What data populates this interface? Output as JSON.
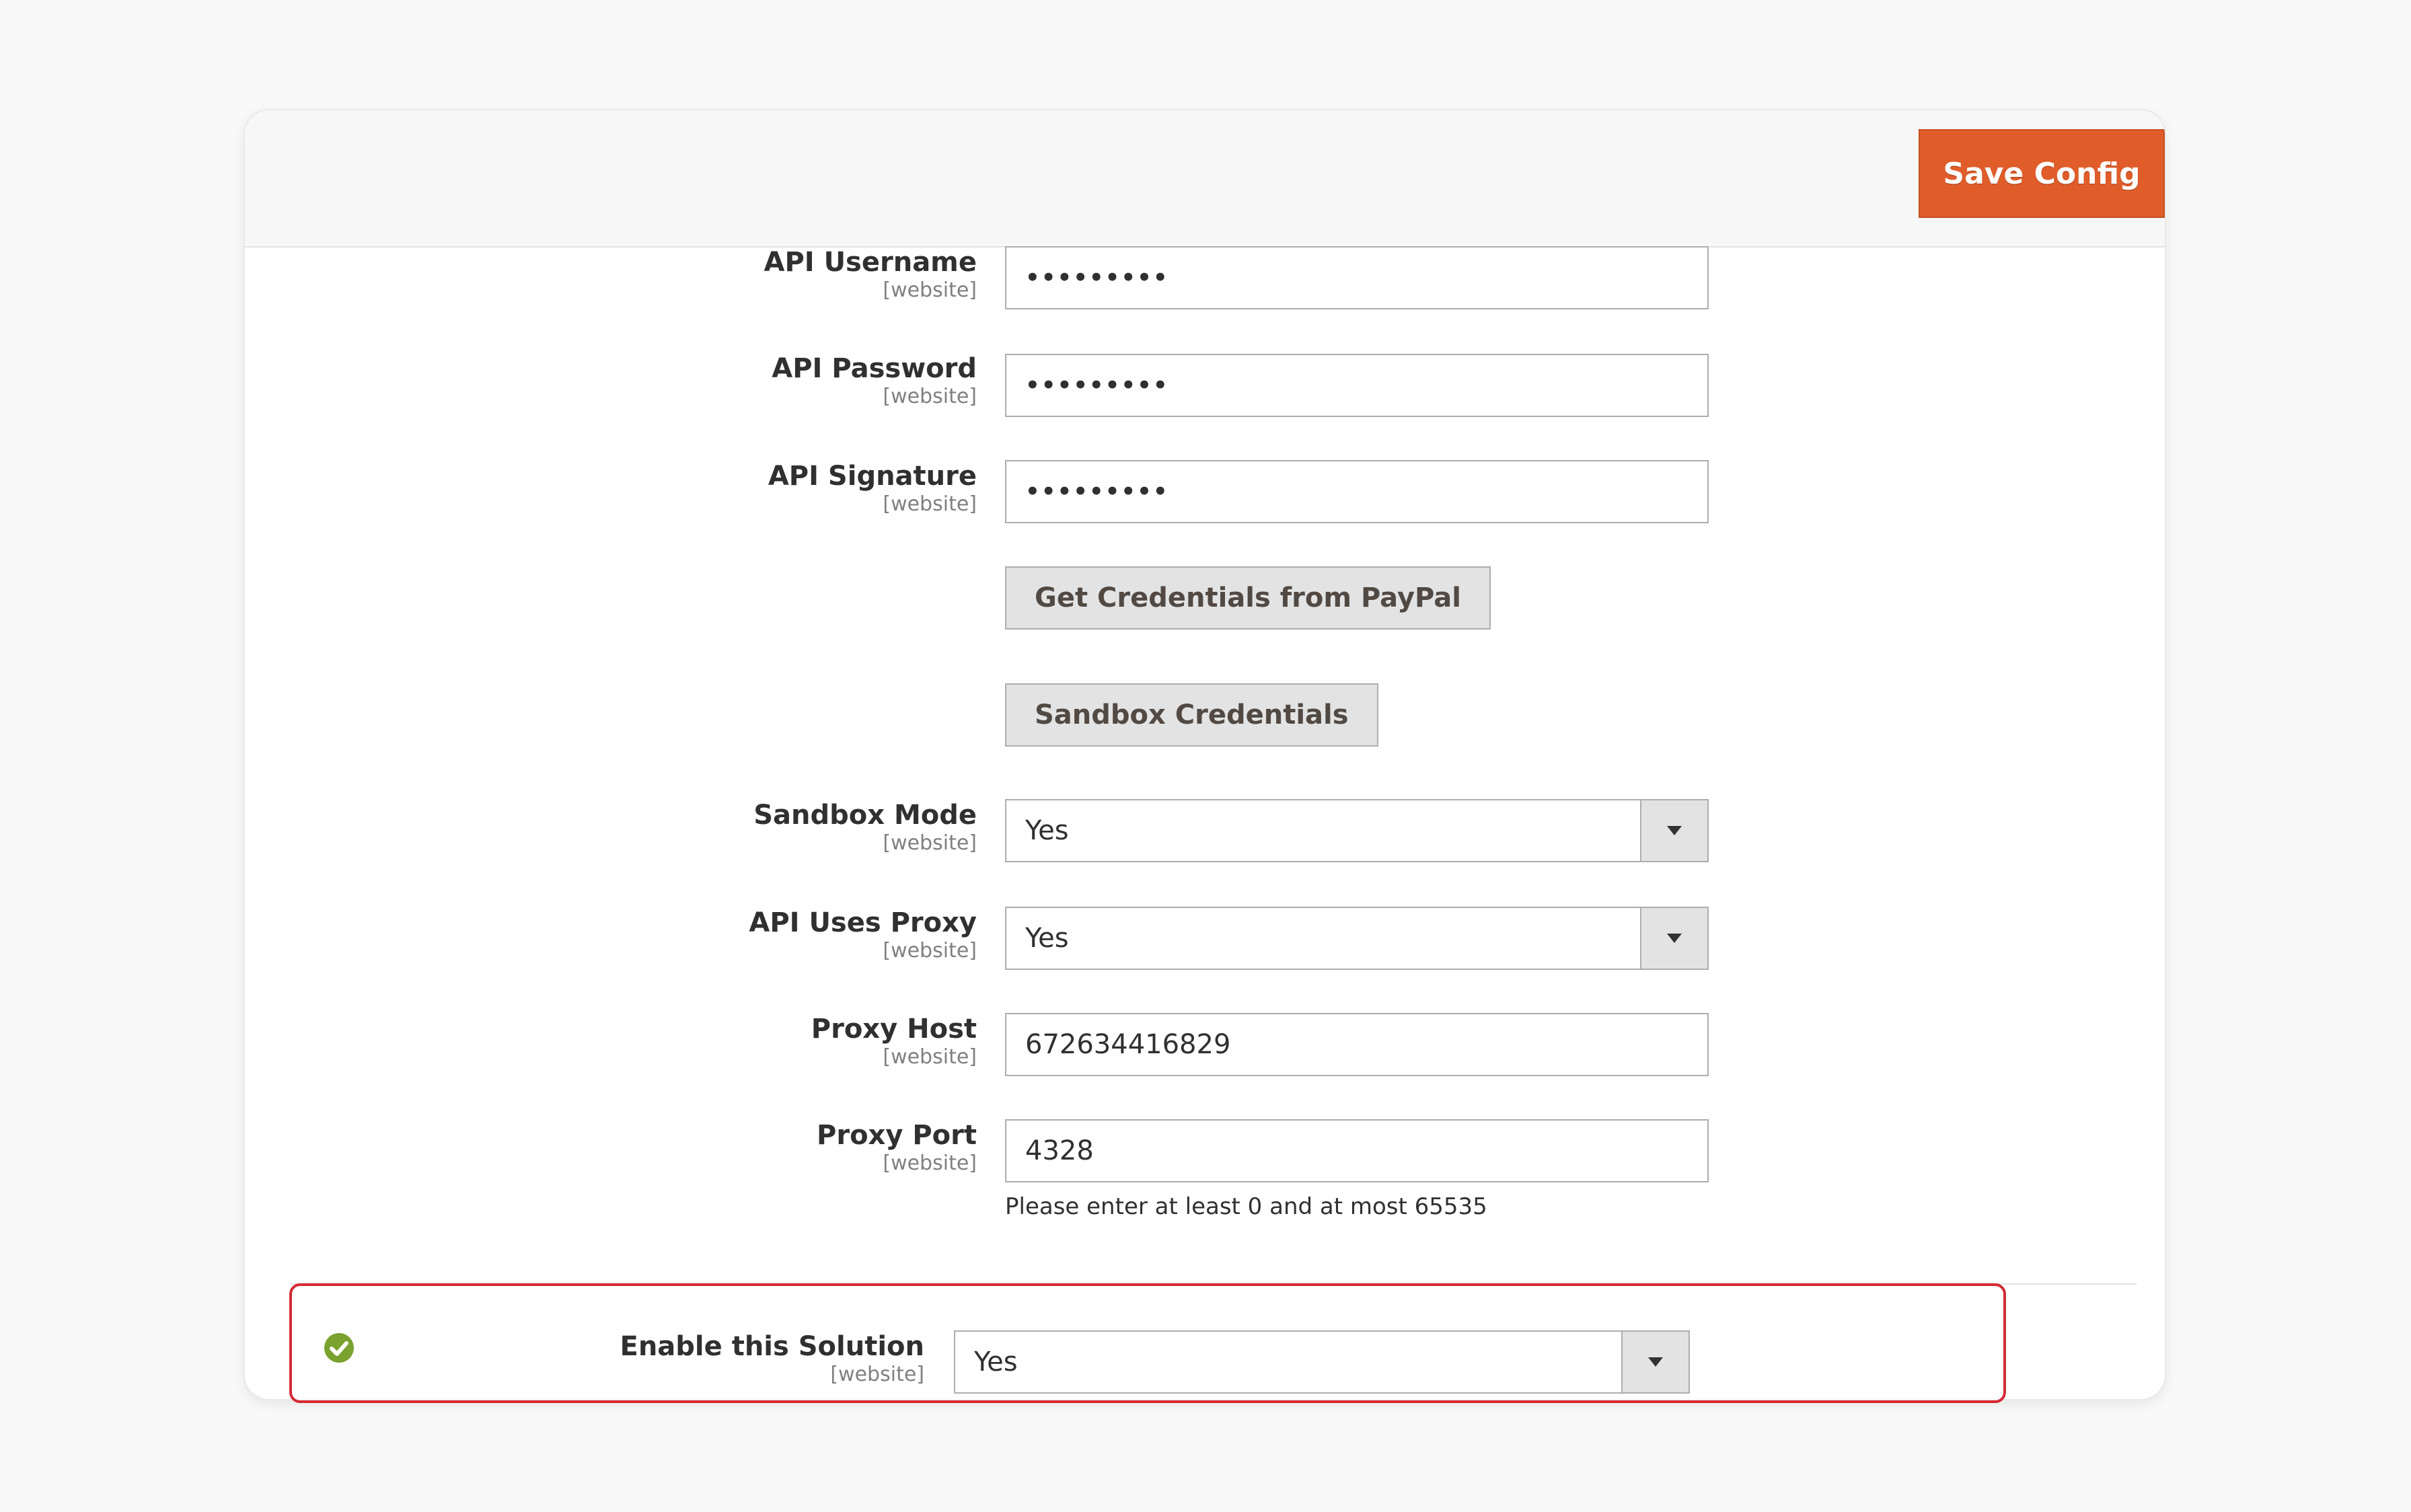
{
  "header": {
    "save_label": "Save Config"
  },
  "colors": {
    "accent": "#e05d2a",
    "highlight_border": "#d42b35",
    "success": "#79a22e"
  },
  "fields": [
    {
      "label": "API Username",
      "scope": "[website]",
      "type": "password",
      "value": "•••••••••"
    },
    {
      "label": "API Password",
      "scope": "[website]",
      "type": "password",
      "value": "•••••••••"
    },
    {
      "label": "API Signature",
      "scope": "[website]",
      "type": "password",
      "value": "•••••••••"
    }
  ],
  "buttons": {
    "get_credentials": "Get Credentials from PayPal",
    "sandbox_credentials": "Sandbox Credentials"
  },
  "selects": {
    "sandbox_mode": {
      "label": "Sandbox Mode",
      "scope": "[website]",
      "value": "Yes"
    },
    "api_uses_proxy": {
      "label": "API Uses Proxy",
      "scope": "[website]",
      "value": "Yes"
    }
  },
  "proxy": {
    "host": {
      "label": "Proxy Host",
      "scope": "[website]",
      "value": "672634416829"
    },
    "port": {
      "label": "Proxy Port",
      "scope": "[website]",
      "value": "4328",
      "note": "Please enter at least 0 and at most 65535"
    }
  },
  "solution": {
    "label": "Enable this Solution",
    "scope": "[website]",
    "value": "Yes",
    "status_icon": "check-circle-icon"
  }
}
